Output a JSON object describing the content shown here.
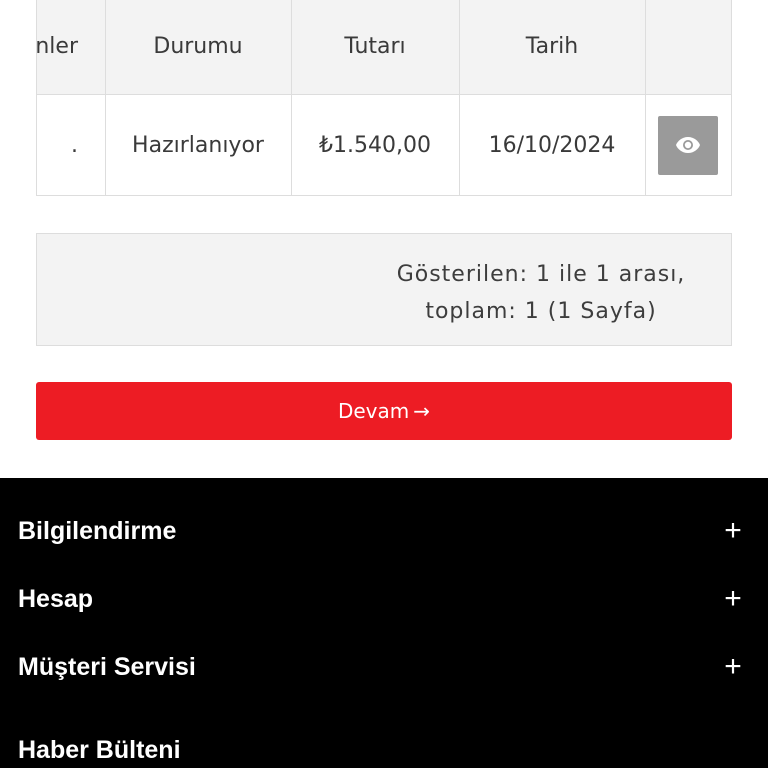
{
  "table": {
    "headers": {
      "products": "nler",
      "status": "Durumu",
      "amount": "Tutarı",
      "date": "Tarih"
    },
    "rows": [
      {
        "products": ".",
        "status": "Hazırlanıyor",
        "amount": "₺1.540,00",
        "date": "16/10/2024",
        "action_icon": "eye-icon"
      }
    ]
  },
  "pagination": {
    "line1": "Gösterilen: 1 ile 1 arası,",
    "line2": "toplam: 1 (1 Sayfa)"
  },
  "continue_button": {
    "label": "Devam",
    "arrow": "→"
  },
  "footer": {
    "sections": [
      {
        "label": "Bilgilendirme",
        "toggle": "+"
      },
      {
        "label": "Hesap",
        "toggle": "+"
      },
      {
        "label": "Müşteri Servisi",
        "toggle": "+"
      }
    ],
    "newsletter_title": "Haber Bülteni"
  },
  "colors": {
    "accent": "#ed1c24",
    "footer_bg": "#000000",
    "table_header_bg": "#f3f3f3",
    "view_button_bg": "#9a9a9a"
  }
}
